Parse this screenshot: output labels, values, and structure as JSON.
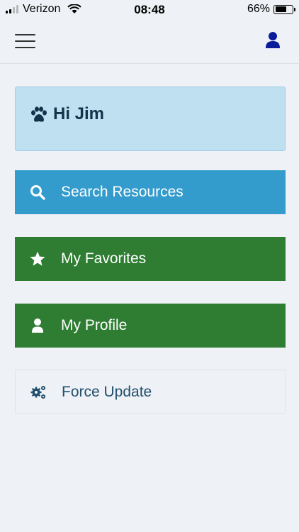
{
  "status": {
    "carrier": "Verizon",
    "time": "08:48",
    "battery": "66%",
    "battery_level": 0.66
  },
  "nav": {
    "menu_icon": "hamburger-menu-icon",
    "user_icon": "user-icon"
  },
  "greeting": {
    "text": "Hi Jim",
    "icon": "paw-icon"
  },
  "menu": {
    "search": {
      "label": "Search Resources",
      "icon": "search-icon"
    },
    "favorites": {
      "label": "My Favorites",
      "icon": "star-icon"
    },
    "profile": {
      "label": "My Profile",
      "icon": "user-icon"
    },
    "force_update": {
      "label": "Force Update",
      "icon": "gears-icon"
    }
  },
  "colors": {
    "background": "#eef1f5",
    "greeting_bg": "#bee0f0",
    "search_bg": "#339ccc",
    "green_bg": "#2e7d32",
    "user_icon": "#0b1d9a",
    "force_text": "#21506e"
  }
}
